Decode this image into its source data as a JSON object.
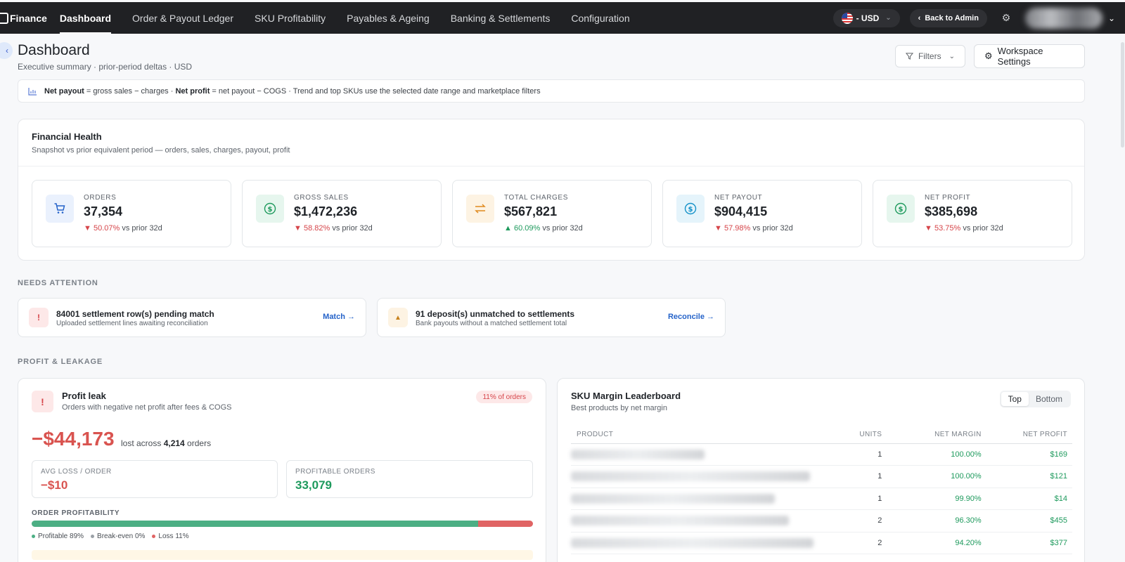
{
  "nav": {
    "brand": "Finance",
    "items": [
      {
        "label": "Dashboard",
        "active": true
      },
      {
        "label": "Order & Payout Ledger",
        "active": false
      },
      {
        "label": "SKU Profitability",
        "active": false
      },
      {
        "label": "Payables & Ageing",
        "active": false
      },
      {
        "label": "Banking & Settlements",
        "active": false
      },
      {
        "label": "Configuration",
        "active": false
      }
    ],
    "currency": "- USD",
    "back_admin": "Back to Admin"
  },
  "header": {
    "title": "Dashboard",
    "subtitle": "Executive summary · prior-period deltas · USD",
    "filters_label": "Filters",
    "workspace_settings_label": "Workspace Settings"
  },
  "info": {
    "net_payout_bold": "Net payout",
    "net_payout_def": " = gross sales − charges · ",
    "net_profit_bold": "Net profit",
    "net_profit_def": " = net payout − COGS · Trend and top SKUs use the selected date range and marketplace filters"
  },
  "financial_health": {
    "title": "Financial Health",
    "subtitle": "Snapshot vs prior equivalent period — orders, sales, charges, payout, profit",
    "kpis": [
      {
        "label": "ORDERS",
        "value": "37,354",
        "delta": "50.07%",
        "direction": "down",
        "suffix": " vs prior 32d",
        "icon": "cart-icon",
        "icon_color": "#2563c9",
        "icon_bg": "#eaf1fd"
      },
      {
        "label": "GROSS SALES",
        "value": "$1,472,236",
        "delta": "58.82%",
        "direction": "down",
        "suffix": " vs prior 32d",
        "icon": "dollar-icon",
        "icon_color": "#1e9a5d",
        "icon_bg": "#e6f6ee"
      },
      {
        "label": "TOTAL CHARGES",
        "value": "$567,821",
        "delta": "60.09%",
        "direction": "up",
        "suffix": " vs prior 32d",
        "icon": "swap-icon",
        "icon_color": "#e08a1e",
        "icon_bg": "#fdf3e3"
      },
      {
        "label": "NET PAYOUT",
        "value": "$904,415",
        "delta": "57.98%",
        "direction": "down",
        "suffix": " vs prior 32d",
        "icon": "dollar-icon",
        "icon_color": "#1592c9",
        "icon_bg": "#e5f4fb"
      },
      {
        "label": "NET PROFIT",
        "value": "$385,698",
        "delta": "53.75%",
        "direction": "down",
        "suffix": " vs prior 32d",
        "icon": "dollar-icon",
        "icon_color": "#1e9a5d",
        "icon_bg": "#e6f6ee"
      }
    ]
  },
  "needs_attention": {
    "label": "NEEDS ATTENTION",
    "items": [
      {
        "title": "84001 settlement row(s) pending match",
        "desc": "Uploaded settlement lines awaiting reconciliation",
        "link": "Match →",
        "icon": "!"
      },
      {
        "title": "91 deposit(s) unmatched to settlements",
        "desc": "Bank payouts without a matched settlement total",
        "link": "Reconcile →",
        "icon": "▲"
      }
    ]
  },
  "profit_leakage": {
    "label": "PROFIT & LEAKAGE",
    "profit_leak": {
      "title": "Profit leak",
      "subtitle": "Orders with negative net profit after fees & COGS",
      "badge": "11% of orders",
      "loss": "−$44,173",
      "loss_note_prefix": "lost across ",
      "loss_orders": "4,214",
      "loss_note_suffix": " orders",
      "avg_loss_label": "AVG LOSS / ORDER",
      "avg_loss_value": "−$10",
      "profitable_label": "PROFITABLE ORDERS",
      "profitable_value": "33,079",
      "order_profitability_label": "ORDER PROFITABILITY",
      "profitable_pct": 89,
      "breakeven_pct": 0,
      "loss_pct": 11,
      "legend_profitable": "Profitable 89%",
      "legend_breakeven": "Break-even 0%",
      "legend_loss": "Loss 11%"
    },
    "sku_leaderboard": {
      "title": "SKU Margin Leaderboard",
      "subtitle": "Best products by net margin",
      "toggle_top": "Top",
      "toggle_bottom": "Bottom",
      "columns": [
        "PRODUCT",
        "UNITS",
        "NET MARGIN",
        "NET PROFIT"
      ],
      "rows": [
        {
          "units": "1",
          "margin": "100.00%",
          "profit": "$169"
        },
        {
          "units": "1",
          "margin": "100.00%",
          "profit": "$121"
        },
        {
          "units": "1",
          "margin": "99.90%",
          "profit": "$14"
        },
        {
          "units": "2",
          "margin": "96.30%",
          "profit": "$455"
        },
        {
          "units": "2",
          "margin": "94.20%",
          "profit": "$377"
        }
      ]
    }
  },
  "colors": {
    "nav_bg": "#202124",
    "down": "#d6454a",
    "up": "#1e9a5d",
    "link": "#2563c9"
  }
}
